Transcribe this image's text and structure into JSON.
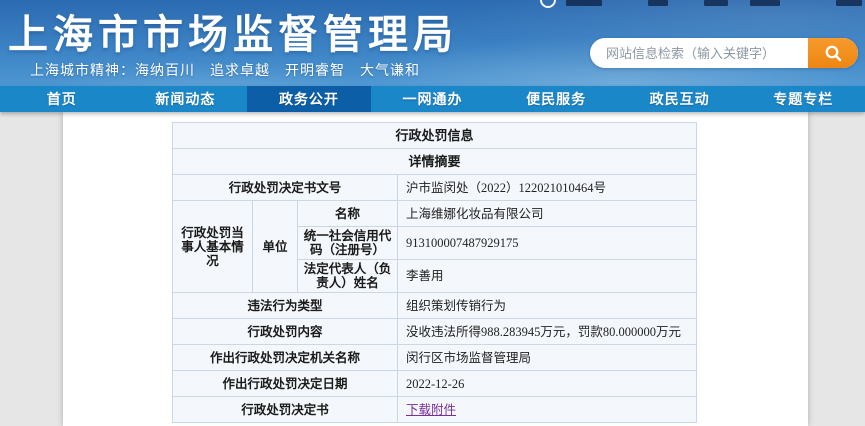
{
  "header": {
    "site_title": "上海市市场监督管理局",
    "motto": "上海城市精神：海纳百川　追求卓越　开明睿智　大气谦和",
    "search": {
      "placeholder": "网站信息检索（输入关键字）"
    }
  },
  "nav": {
    "items": [
      {
        "label": "首页"
      },
      {
        "label": "新闻动态"
      },
      {
        "label": "政务公开",
        "active": true
      },
      {
        "label": "一网通办"
      },
      {
        "label": "便民服务"
      },
      {
        "label": "政民互动"
      },
      {
        "label": "专题专栏"
      }
    ]
  },
  "table": {
    "title": "行政处罚信息",
    "subtitle": "详情摘要",
    "doc_no": {
      "label": "行政处罚决定书文号",
      "value": "沪市监闵处（2022）122021010464号"
    },
    "party": {
      "section_label": "行政处罚当事人基本情况",
      "unit_label": "单位",
      "name": {
        "label": "名称",
        "value": "上海维娜化妆品有限公司"
      },
      "credit_code": {
        "label": "统一社会信用代码（注册号）",
        "value": "913100007487929175"
      },
      "legal_rep": {
        "label": "法定代表人（负责人）姓名",
        "value": "李善用"
      }
    },
    "violation_type": {
      "label": "违法行为类型",
      "value": "组织策划传销行为"
    },
    "penalty": {
      "label": "行政处罚内容",
      "value": "没收违法所得988.283945万元，罚款80.000000万元"
    },
    "authority": {
      "label": "作出行政处罚决定机关名称",
      "value": "闵行区市场监督管理局"
    },
    "date": {
      "label": "作出行政处罚决定日期",
      "value": "2022-12-26"
    },
    "decision_doc": {
      "label": "行政处罚决定书",
      "link_text": "下载附件"
    }
  },
  "colors": {
    "header_blue": "#2c6ab0",
    "nav_blue": "#1a87c9",
    "nav_active_blue": "#0c5fa6",
    "search_button_orange": "#ee8512",
    "link_purple": "#7b2d9e",
    "cell_bg": "#f4f7fb",
    "cell_border": "#c9d7e6"
  }
}
